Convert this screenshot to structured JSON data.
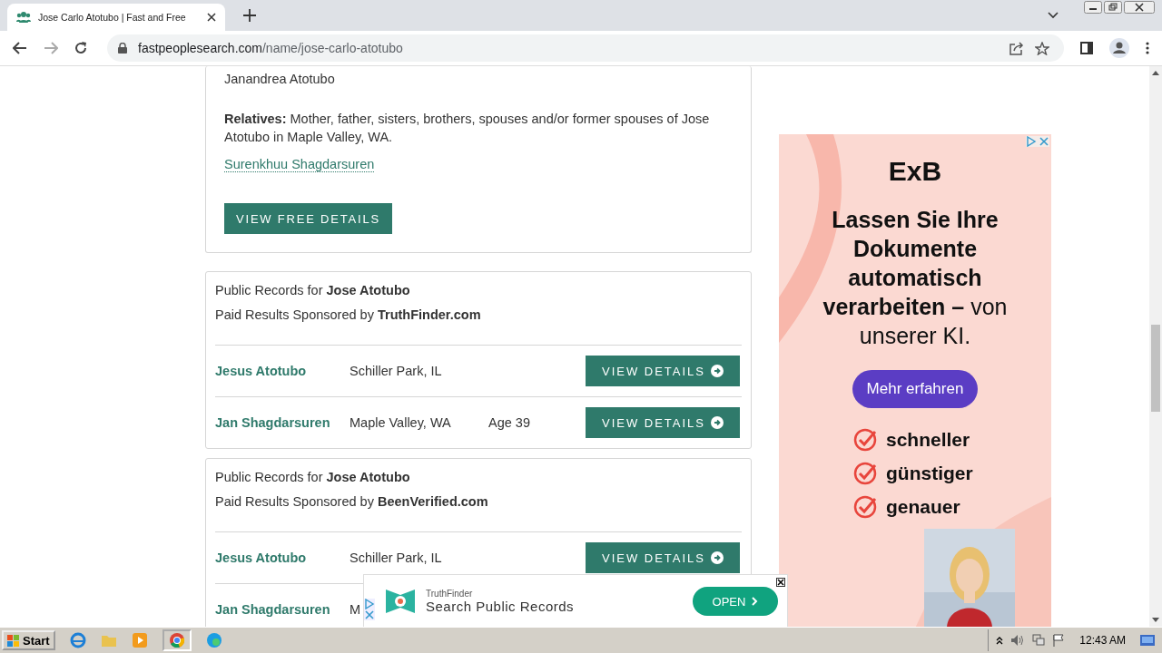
{
  "browser": {
    "tab_title": "Jose Carlo Atotubo | Fast and Free",
    "url_domain": "fastpeoplesearch.com",
    "url_path": "/name/jose-carlo-atotubo"
  },
  "top_card": {
    "name_line": "Janandrea Atotubo",
    "relatives_text": "**Relatives:** Mother, father, sisters, brothers, spouses and/or former spouses of Jose Atotubo in Maple Valley, WA.",
    "relative_link": "Surenkhuu Shagdarsuren",
    "button": "VIEW FREE DETAILS"
  },
  "record_cards": [
    {
      "title": "Public Records for **Jose Atotubo**",
      "sponsor": "Paid Results Sponsored by **TruthFinder.com**",
      "rows": [
        {
          "name": "Jesus Atotubo",
          "location": "Schiller Park, IL",
          "button": "VIEW DETAILS"
        },
        {
          "name": "Jan Shagdarsuren",
          "location": "Maple Valley, WA",
          "age": "Age 39",
          "button": "VIEW DETAILS"
        }
      ]
    },
    {
      "title": "Public Records for **Jose Atotubo**",
      "sponsor": "Paid Results Sponsored by **BeenVerified.com**",
      "rows": [
        {
          "name": "Jesus Atotubo",
          "location": "Schiller Park, IL",
          "button": "VIEW DETAILS"
        },
        {
          "name": "Jan Shagdarsuren",
          "location": "M"
        }
      ]
    }
  ],
  "side_ad": {
    "brand": "ExB",
    "headline": "**Lassen Sie Ihre Dokumente automatisch verarbeiten –** von unserer KI.",
    "cta": "Mehr erfahren",
    "benefits": [
      "schneller",
      "günstiger",
      "genauer"
    ]
  },
  "bottom_ad": {
    "brand": "TruthFinder",
    "title": "Search Public Records",
    "button": "OPEN"
  },
  "taskbar": {
    "start": "Start",
    "clock": "12:43 AM"
  }
}
